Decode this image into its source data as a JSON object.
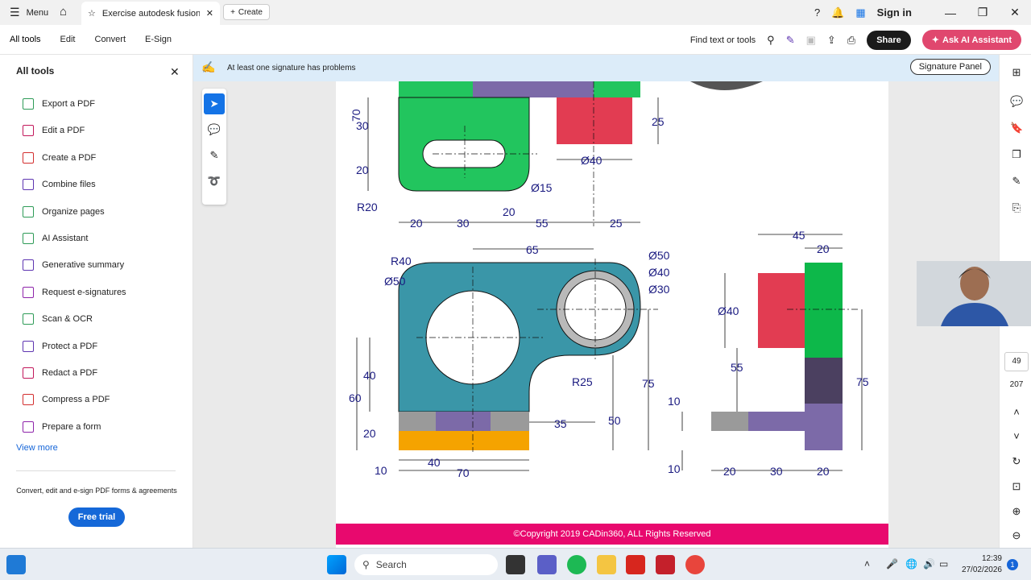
{
  "titlebar": {
    "menu_label": "Menu",
    "tab_title": "Exercise autodesk fusion...",
    "create_label": "Create",
    "signin_label": "Sign in"
  },
  "toolbar": {
    "menus": [
      "All tools",
      "Edit",
      "Convert",
      "E-Sign"
    ],
    "find_label": "Find text or tools",
    "share_label": "Share",
    "ai_label": "Ask AI Assistant"
  },
  "sidebar": {
    "title": "All tools",
    "items": [
      {
        "label": "Export a PDF",
        "color": "#2e9b57"
      },
      {
        "label": "Edit a PDF",
        "color": "#c2185b"
      },
      {
        "label": "Create a PDF",
        "color": "#d32f2f"
      },
      {
        "label": "Combine files",
        "color": "#5e35b1"
      },
      {
        "label": "Organize pages",
        "color": "#2e9b57"
      },
      {
        "label": "AI Assistant",
        "color": "#2e9b57"
      },
      {
        "label": "Generative summary",
        "color": "#5e35b1"
      },
      {
        "label": "Request e-signatures",
        "color": "#8e24aa"
      },
      {
        "label": "Scan & OCR",
        "color": "#2e9b57"
      },
      {
        "label": "Protect a PDF",
        "color": "#5e35b1"
      },
      {
        "label": "Redact a PDF",
        "color": "#c2185b"
      },
      {
        "label": "Compress a PDF",
        "color": "#d32f2f"
      },
      {
        "label": "Prepare a form",
        "color": "#8e24aa"
      }
    ],
    "view_more": "View more",
    "promo": "Convert, edit and e-sign PDF forms & agreements",
    "trial_label": "Free trial"
  },
  "viewer": {
    "signature_warning": "At least one signature has problems",
    "signature_panel": "Signature Panel",
    "copyright": "©Copyright 2019 CADin360, ALL Rights Reserved",
    "page_current": "49",
    "page_total": "207"
  },
  "drawing": {
    "top_left_dims": [
      "70",
      "30",
      "20",
      "R20",
      "20",
      "30",
      "20",
      "55",
      "25",
      "Ø15",
      "Ø40",
      "25"
    ],
    "main_dims": [
      "R40",
      "Ø50",
      "65",
      "Ø50",
      "Ø40",
      "Ø30",
      "R25",
      "40",
      "60",
      "20",
      "10",
      "75",
      "50",
      "35",
      "40",
      "70"
    ],
    "right_dims": [
      "45",
      "20",
      "Ø40",
      "55",
      "75",
      "10",
      "10",
      "20",
      "30",
      "20"
    ]
  },
  "taskbar": {
    "search_label": "Search",
    "time": "12:39",
    "date": "27/02/2026"
  }
}
